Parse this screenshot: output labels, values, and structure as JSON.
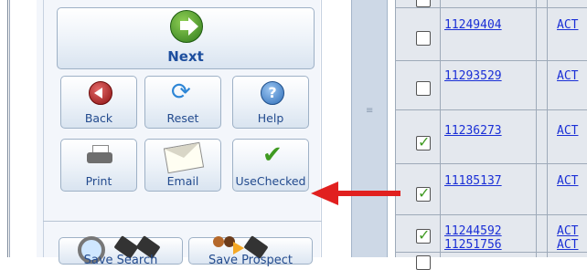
{
  "nav": {
    "next_label": "Next",
    "back_label": "Back",
    "reset_label": "Reset",
    "help_label": "Help",
    "print_label": "Print",
    "email_label": "Email",
    "usechecked_label": "UseChecked",
    "save_search_label": "Save Search",
    "save_prospect_label": "Save Prospect"
  },
  "icons": {
    "next": "right-arrow-circle-icon",
    "back": "left-arrow-circle-icon",
    "reset": "refresh-icon",
    "help": "question-mark-icon",
    "print": "printer-icon",
    "email": "envelope-icon",
    "usechecked": "checkmark-icon",
    "save_search": "magnifier-floppy-icon",
    "save_prospect": "people-floppy-icon"
  },
  "results": {
    "rows": [
      {
        "id": "11249404",
        "status": "ACT",
        "checked": false
      },
      {
        "id": "11293529",
        "status": "ACT",
        "checked": false
      },
      {
        "id": "11236273",
        "status": "ACT",
        "checked": true
      },
      {
        "id": "11185137",
        "status": "ACT",
        "checked": true
      },
      {
        "id": "11244592",
        "status": "ACT",
        "checked": true
      },
      {
        "id": "11251756",
        "status": "ACT",
        "checked": false
      }
    ]
  },
  "colors": {
    "accent_link": "#1a2fd6",
    "annotation_arrow": "#e1201f",
    "check_green": "#3f9a21"
  }
}
